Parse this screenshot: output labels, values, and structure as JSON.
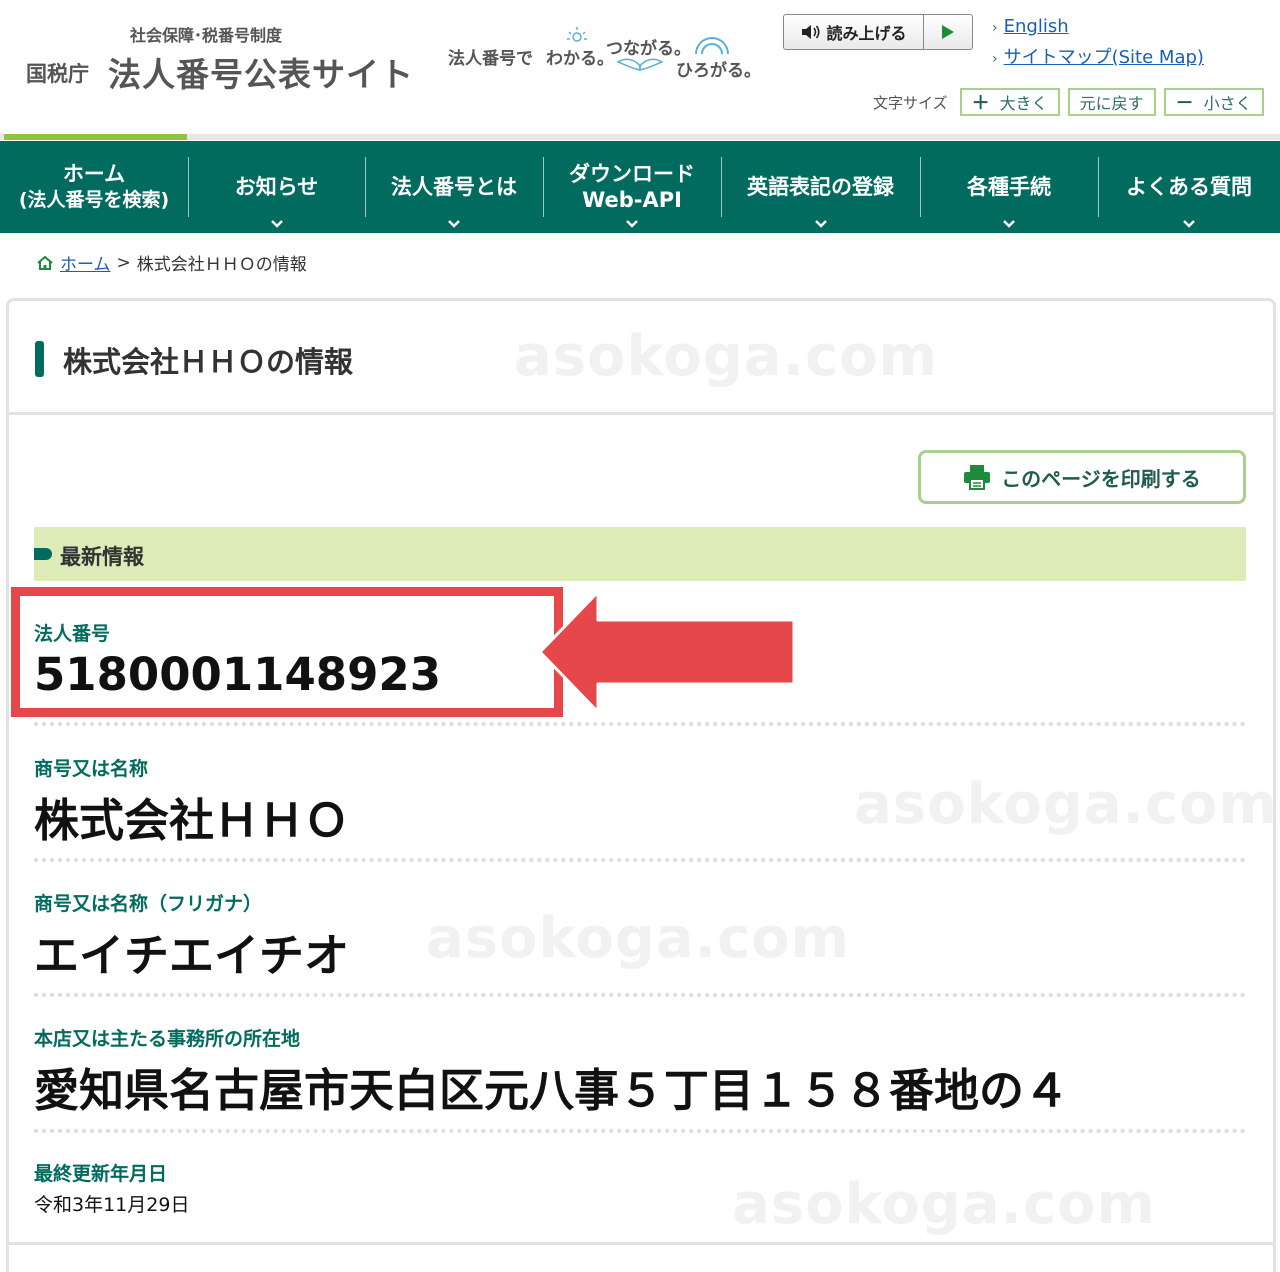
{
  "header": {
    "logo_sub": "社会保障･税番号制度",
    "logo_agency": "国税庁",
    "logo_title": "法人番号公表サイト",
    "slogan": {
      "a": "法人番号で",
      "b": "わかる。",
      "c": "つながる。",
      "d": "ひろがる。"
    },
    "readaloud_label": "読み上げる",
    "links": [
      {
        "label": "English"
      },
      {
        "label": "サイトマップ(Site Map)"
      }
    ],
    "fontsize": {
      "label": "文字サイズ",
      "larger": "大きく",
      "reset": "元に戻す",
      "smaller": "小さく"
    }
  },
  "nav": {
    "items": [
      {
        "line1": "ホーム",
        "line2": "(法人番号を検索)"
      },
      {
        "line1": "お知らせ",
        "line2": ""
      },
      {
        "line1": "法人番号とは",
        "line2": ""
      },
      {
        "line1": "ダウンロード",
        "line2": "Web-API"
      },
      {
        "line1": "英語表記の登録",
        "line2": ""
      },
      {
        "line1": "各種手続",
        "line2": ""
      },
      {
        "line1": "よくある質問",
        "line2": ""
      }
    ]
  },
  "breadcrumb": {
    "home": "ホーム",
    "separator": ">",
    "current": "株式会社ＨＨＯの情報"
  },
  "page": {
    "title": "株式会社ＨＨＯの情報",
    "watermark": "asokoga.com",
    "print_label": "このページを印刷する",
    "section_title": "最新情報"
  },
  "fields": {
    "corporate_number": {
      "label": "法人番号",
      "value": "5180001148923"
    },
    "name": {
      "label": "商号又は名称",
      "value": "株式会社ＨＨＯ"
    },
    "furigana": {
      "label": "商号又は名称（フリガナ）",
      "value": "エイチエイチオ"
    },
    "address": {
      "label": "本店又は主たる事務所の所在地",
      "value": "愛知県名古屋市天白区元八事５丁目１５８番地の４"
    },
    "updated": {
      "label": "最終更新年月日",
      "value": "令和3年11月29日"
    }
  },
  "colors": {
    "nav_green": "#006b5e",
    "accent_light_green": "#dcebb8",
    "highlight_red": "#e5474b",
    "link_blue": "#1a5fb4"
  }
}
